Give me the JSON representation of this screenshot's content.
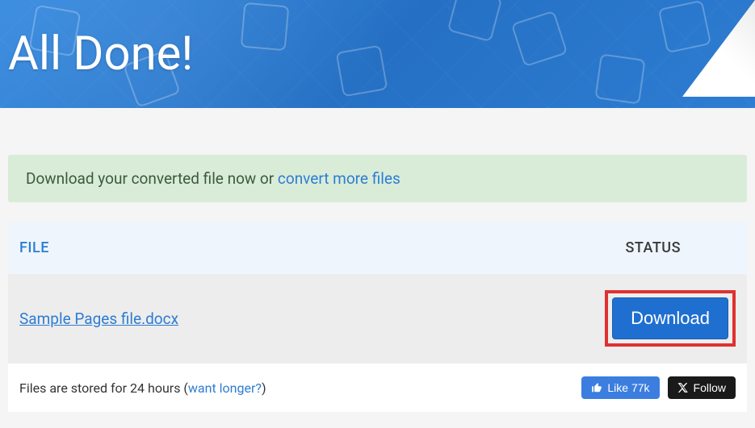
{
  "hero": {
    "title": "All Done!"
  },
  "alert": {
    "prefix": "Download your converted file now or ",
    "link_text": "convert more files"
  },
  "table": {
    "headers": {
      "file": "FILE",
      "status": "STATUS"
    },
    "row": {
      "filename": "Sample Pages file.docx",
      "download_label": "Download"
    }
  },
  "footer": {
    "text_prefix": "Files are stored for 24 hours (",
    "link_text": "want longer?",
    "text_suffix": ")",
    "like_label": "Like 77k",
    "follow_label": "Follow"
  },
  "colors": {
    "accent": "#2d7dd2",
    "highlight_border": "#e03030",
    "alert_bg": "#d9ecd8"
  }
}
